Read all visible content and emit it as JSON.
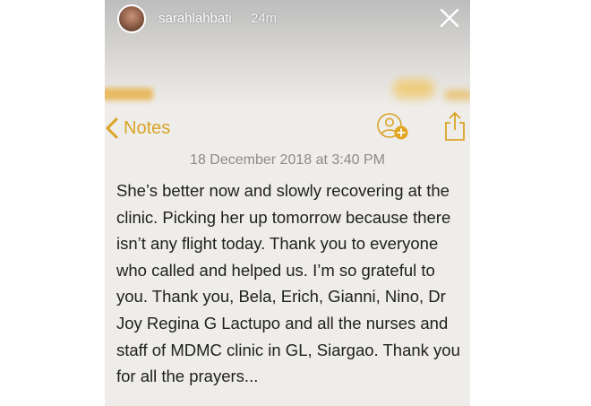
{
  "story": {
    "username": "sarahlahbati",
    "time_ago": "24m"
  },
  "notes_app": {
    "back_label": "Notes",
    "date": "18 December 2018 at 3:40 PM",
    "body": "She’s better now and slowly recovering at the clinic. Picking her up tomorrow because there isn’t any flight today. Thank you to everyone who called and helped us. I’m so grateful to you. Thank you, Bela, Erich, Gianni, Nino, Dr Joy Regina G Lactupo and all the nurses and staff of MDMC clinic in GL, Siargao. Thank you for all the prayers..."
  },
  "icons": {
    "close": "close-icon",
    "back": "chevron-left-icon",
    "add_people": "add-people-icon",
    "share": "share-icon"
  },
  "colors": {
    "accent": "#d9a325",
    "date_text": "#8c8b88",
    "body_text": "#202020",
    "paper": "#efedea"
  }
}
